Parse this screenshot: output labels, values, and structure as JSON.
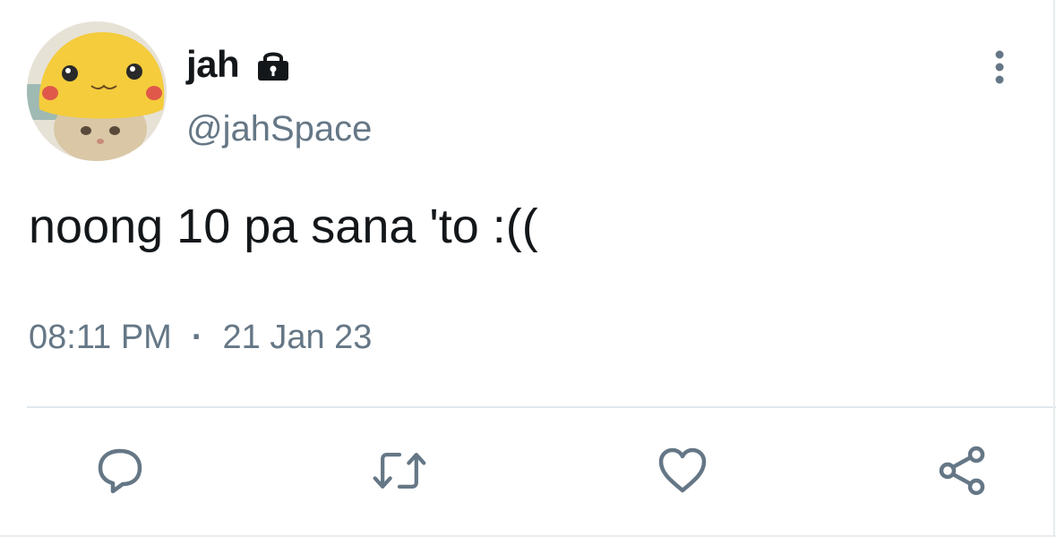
{
  "author": {
    "display_name": "jah",
    "handle": "@jahSpace",
    "protected_icon": "lock-icon",
    "avatar_icon": "avatar-cat-in-pikachu-hat"
  },
  "tweet": {
    "text": "noong 10 pa sana 'to :((",
    "time": "08:11 PM",
    "separator": "·",
    "date": "21 Jan 23"
  },
  "menu": {
    "icon": "more-vertical-icon"
  },
  "actions": [
    {
      "name": "reply",
      "icon": "comment-icon"
    },
    {
      "name": "retweet",
      "icon": "retweet-icon"
    },
    {
      "name": "like",
      "icon": "heart-icon"
    },
    {
      "name": "share",
      "icon": "share-icon"
    }
  ],
  "colors": {
    "text_primary": "#14171a",
    "text_secondary": "#657786",
    "divider": "#e1e8ed",
    "icon": "#657786"
  }
}
